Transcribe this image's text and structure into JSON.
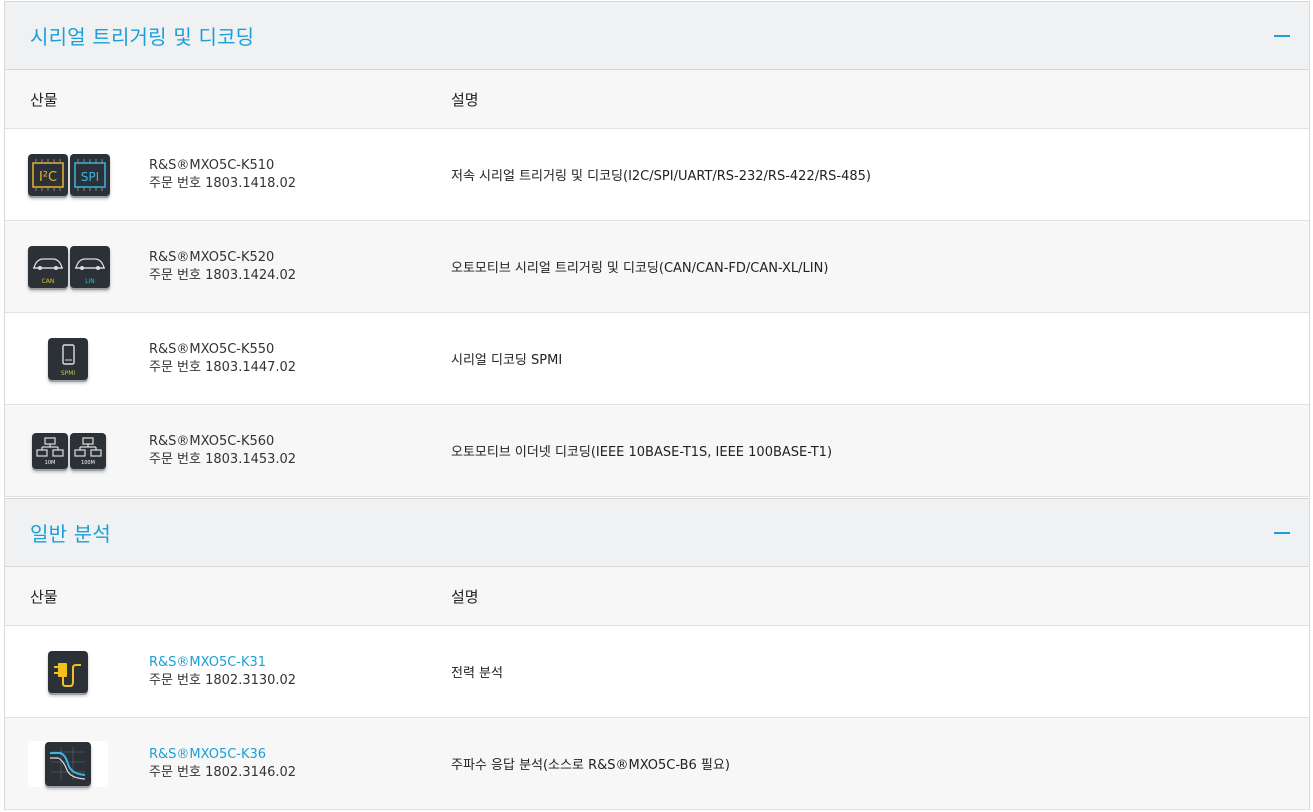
{
  "sections": [
    {
      "title": "시리얼 트리거링 및 디코딩",
      "col_product": "산물",
      "col_description": "설명",
      "rows": [
        {
          "product": "R&S®MXO5C-K510",
          "order": "주문 번호 1803.1418.02",
          "description": "저속 시리얼 트리거링 및 디코딩(I2C/SPI/UART/RS-232/RS-422/RS-485)",
          "icon": "i2c-spi-icon"
        },
        {
          "product": "R&S®MXO5C-K520",
          "order": "주문 번호 1803.1424.02",
          "description": "오토모티브 시리얼 트리거링 및 디코딩(CAN/CAN-FD/CAN-XL/LIN)",
          "icon": "can-lin-icon",
          "labels": [
            "CAN",
            "LIN"
          ]
        },
        {
          "product": "R&S®MXO5C-K550",
          "order": "주문 번호 1803.1447.02",
          "description": "시리얼 디코딩 SPMI",
          "icon": "spmi-icon",
          "labels": [
            "SPMI"
          ]
        },
        {
          "product": "R&S®MXO5C-K560",
          "order": "주문 번호 1803.1453.02",
          "description": "오토모티브 이더넷 디코딩(IEEE 10BASE-T1S, IEEE 100BASE-T1)",
          "icon": "ethernet-icon",
          "labels": [
            "10M",
            "100M"
          ]
        }
      ]
    },
    {
      "title": "일반 분석",
      "col_product": "산물",
      "col_description": "설명",
      "rows": [
        {
          "product": "R&S®MXO5C-K31",
          "order": "주문 번호 1802.3130.02",
          "description": "전력 분석",
          "icon": "power-plug-icon"
        },
        {
          "product": "R&S®MXO5C-K36",
          "order": "주문 번호 1802.3146.02",
          "description": "주파수 응답 분석(소스로 R&S®MXO5C-B6 필요)",
          "icon": "frequency-response-icon"
        }
      ]
    }
  ],
  "colors": {
    "accent": "#1a9fd6",
    "header_bg": "#f0f1f3",
    "tile": "#2b3136"
  }
}
